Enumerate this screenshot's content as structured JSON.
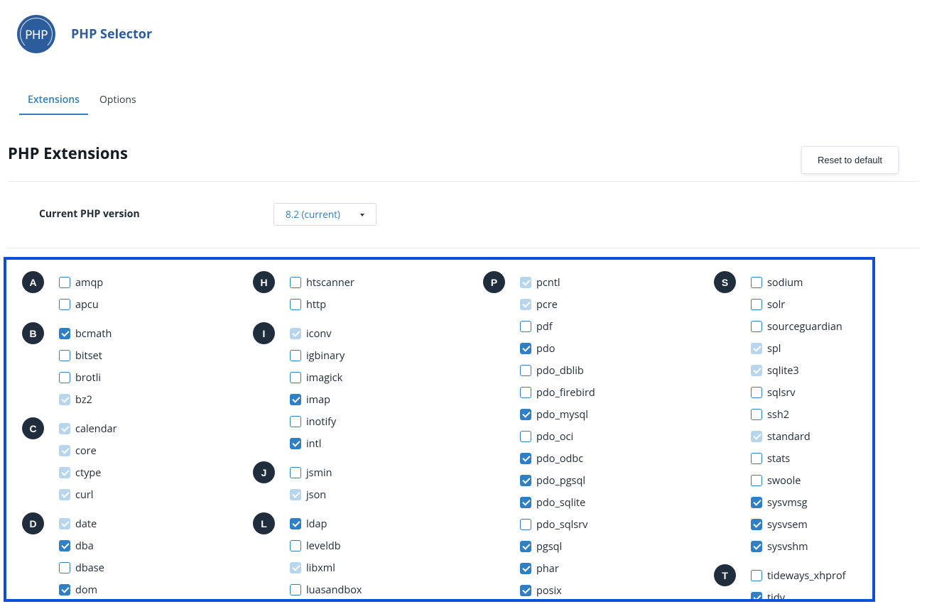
{
  "header": {
    "logo_text": "PHP",
    "title": "PHP Selector"
  },
  "tabs": [
    {
      "label": "Extensions"
    },
    {
      "label": "Options"
    }
  ],
  "page": {
    "section_title": "PHP Extensions",
    "reset_label": "Reset to default"
  },
  "version": {
    "label": "Current PHP version",
    "selected": "8.2 (current)"
  },
  "columns": [
    {
      "groups": [
        {
          "letter": "A",
          "items": [
            {
              "name": "amqp",
              "state": "unchecked"
            },
            {
              "name": "apcu",
              "state": "unchecked"
            }
          ]
        },
        {
          "letter": "B",
          "items": [
            {
              "name": "bcmath",
              "state": "checked"
            },
            {
              "name": "bitset",
              "state": "unchecked"
            },
            {
              "name": "brotli",
              "state": "unchecked"
            },
            {
              "name": "bz2",
              "state": "disabled-checked"
            }
          ]
        },
        {
          "letter": "C",
          "items": [
            {
              "name": "calendar",
              "state": "disabled-checked"
            },
            {
              "name": "core",
              "state": "disabled-checked"
            },
            {
              "name": "ctype",
              "state": "disabled-checked"
            },
            {
              "name": "curl",
              "state": "disabled-checked"
            }
          ]
        },
        {
          "letter": "D",
          "items": [
            {
              "name": "date",
              "state": "disabled-checked"
            },
            {
              "name": "dba",
              "state": "checked"
            },
            {
              "name": "dbase",
              "state": "unchecked"
            },
            {
              "name": "dom",
              "state": "checked"
            }
          ]
        }
      ]
    },
    {
      "groups": [
        {
          "letter": "H",
          "items": [
            {
              "name": "htscanner",
              "state": "unchecked"
            },
            {
              "name": "http",
              "state": "unchecked"
            }
          ]
        },
        {
          "letter": "I",
          "items": [
            {
              "name": "iconv",
              "state": "disabled-checked"
            },
            {
              "name": "igbinary",
              "state": "unchecked"
            },
            {
              "name": "imagick",
              "state": "unchecked"
            },
            {
              "name": "imap",
              "state": "checked"
            },
            {
              "name": "inotify",
              "state": "unchecked"
            },
            {
              "name": "intl",
              "state": "checked"
            }
          ]
        },
        {
          "letter": "J",
          "items": [
            {
              "name": "jsmin",
              "state": "unchecked"
            },
            {
              "name": "json",
              "state": "disabled-checked"
            }
          ]
        },
        {
          "letter": "L",
          "items": [
            {
              "name": "ldap",
              "state": "checked"
            },
            {
              "name": "leveldb",
              "state": "unchecked"
            },
            {
              "name": "libxml",
              "state": "disabled-checked"
            },
            {
              "name": "luasandbox",
              "state": "unchecked"
            }
          ]
        }
      ]
    },
    {
      "groups": [
        {
          "letter": "P",
          "items": [
            {
              "name": "pcntl",
              "state": "disabled-checked"
            },
            {
              "name": "pcre",
              "state": "disabled-checked"
            },
            {
              "name": "pdf",
              "state": "unchecked"
            },
            {
              "name": "pdo",
              "state": "checked"
            },
            {
              "name": "pdo_dblib",
              "state": "unchecked"
            },
            {
              "name": "pdo_firebird",
              "state": "unchecked"
            },
            {
              "name": "pdo_mysql",
              "state": "checked"
            },
            {
              "name": "pdo_oci",
              "state": "unchecked"
            },
            {
              "name": "pdo_odbc",
              "state": "checked"
            },
            {
              "name": "pdo_pgsql",
              "state": "checked"
            },
            {
              "name": "pdo_sqlite",
              "state": "checked"
            },
            {
              "name": "pdo_sqlsrv",
              "state": "unchecked"
            },
            {
              "name": "pgsql",
              "state": "checked"
            },
            {
              "name": "phar",
              "state": "checked"
            },
            {
              "name": "posix",
              "state": "checked"
            }
          ]
        }
      ]
    },
    {
      "groups": [
        {
          "letter": "S",
          "items": [
            {
              "name": "sodium",
              "state": "unchecked"
            },
            {
              "name": "solr",
              "state": "unchecked"
            },
            {
              "name": "sourceguardian",
              "state": "unchecked"
            },
            {
              "name": "spl",
              "state": "disabled-checked"
            },
            {
              "name": "sqlite3",
              "state": "disabled-checked"
            },
            {
              "name": "sqlsrv",
              "state": "unchecked"
            },
            {
              "name": "ssh2",
              "state": "unchecked"
            },
            {
              "name": "standard",
              "state": "disabled-checked"
            },
            {
              "name": "stats",
              "state": "unchecked"
            },
            {
              "name": "swoole",
              "state": "unchecked"
            },
            {
              "name": "sysvmsg",
              "state": "checked"
            },
            {
              "name": "sysvsem",
              "state": "checked"
            },
            {
              "name": "sysvshm",
              "state": "checked"
            }
          ]
        },
        {
          "letter": "T",
          "items": [
            {
              "name": "tideways_xhprof",
              "state": "unchecked"
            },
            {
              "name": "tidy",
              "state": "checked"
            }
          ]
        }
      ]
    }
  ],
  "colors": {
    "accent": "#2f7fc4",
    "brand": "#2c5c9c",
    "letter_badge": "#1f2d3d",
    "highlight_border": "#0b4fdb"
  }
}
